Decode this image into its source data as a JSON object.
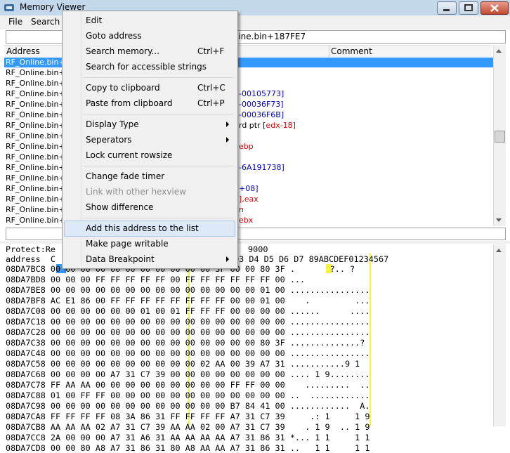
{
  "window": {
    "title": "Memory Viewer"
  },
  "menubar": {
    "file": "File",
    "search": "Search"
  },
  "address_bar": {
    "value": "line.bin+187FE7"
  },
  "disasm": {
    "col_address": "Address",
    "col_comment": "Comment",
    "rows": [
      {
        "addr": "RF_Online.bin+1",
        "a": "",
        "b": "",
        "color": ""
      },
      {
        "addr": "RF_Online.bin+1",
        "a": "",
        "b": "",
        "color": ""
      },
      {
        "addr": "RF_Online.bin+1",
        "a": "",
        "b": "",
        "color": ""
      },
      {
        "addr": "RF_Online.bin+1",
        "a": "-00105773]",
        "b": "",
        "color": "blue"
      },
      {
        "addr": "RF_Online.bin+1",
        "a": "-00036F73]",
        "b": "",
        "color": "blue"
      },
      {
        "addr": "RF_Online.bin+1",
        "a": "-00036F6B]",
        "b": "",
        "color": "blue"
      },
      {
        "addr": "RF_Online.bin+1",
        "a": "rd ptr [",
        "b": "edx-18]",
        "color": "mix"
      },
      {
        "addr": "RF_Online.bin+1",
        "a": "",
        "b": "",
        "color": ""
      },
      {
        "addr": "RF_Online.bin+1",
        "a": "ebp",
        "b": "",
        "color": "red"
      },
      {
        "addr": "RF_Online.bin+1",
        "a": "",
        "b": "",
        "color": ""
      },
      {
        "addr": "RF_Online.bin+1",
        "a": "-6A191738]",
        "b": "",
        "color": "blue"
      },
      {
        "addr": "RF_Online.bin+1",
        "a": "",
        "b": "",
        "color": ""
      },
      {
        "addr": "RF_Online.bin+1",
        "a": "+08]",
        "b": "",
        "color": "blue"
      },
      {
        "addr": "RF_Online.bin+1",
        "a": "],eax",
        "b": "",
        "color": "red"
      },
      {
        "addr": "RF_Online.bin+1",
        "a": "n",
        "b": "",
        "color": "red"
      },
      {
        "addr": "RF_Online.bin+1",
        "a": "ebx",
        "b": "",
        "color": "red"
      }
    ]
  },
  "hex": {
    "protect_prefix": "Protect:Re",
    "protect_suffix": "9000",
    "header_prefix": "address  C",
    "header_suffix": "D3 D4 D5 D6 D7 89ABCDEF01234567",
    "rows": [
      "08DA7BC8 00 00 00 00 00 00 00 00 00 00 00 3F 00 00 80 3F .       ?.. ?",
      "08DA7BD8 00 00 00 FF FF FF FF FF 00 FF FF FF FF FF FF 00 ...          ",
      "08DA7BE8 00 00 00 00 00 00 00 00 00 00 00 00 00 00 01 00 ................",
      "08DA7BF8 AC E1 86 00 FF FF FF FF FF FF FF FF 00 00 01 00    .         ...",
      "08DA7C08 00 00 00 00 00 00 01 00 01 FF FF FF 00 00 00 00 ......      ....",
      "08DA7C18 00 00 00 00 00 00 00 00 00 00 00 00 00 00 00 00 ................",
      "08DA7C28 00 00 00 00 00 00 00 00 00 00 00 00 00 00 00 00 ................",
      "08DA7C38 00 00 00 00 00 00 00 00 00 00 00 00 00 00 80 3F ..............?",
      "08DA7C48 00 00 00 00 00 00 00 00 00 00 00 00 00 00 00 00 ................",
      "08DA7C58 00 00 00 00 00 00 00 00 00 00 02 AA 00 39 A7 31 ...........9 1",
      "08DA7C68 00 00 00 00 A7 31 C7 39 00 00 00 00 00 00 00 00 .... 1 9........",
      "08DA7C78 FF AA AA 00 00 00 00 00 00 00 00 00 FF FF 00 00    .........  ..",
      "08DA7C88 01 00 FF FF 00 00 00 00 00 00 00 00 00 00 00 00 ..  ............",
      "08DA7C98 00 00 00 00 00 00 00 00 00 00 00 00 B7 84 41 00 ............  A.",
      "08DA7CA8 FF FF FF FF 08 3A 86 31 FF FF FF FF A7 31 C7 39     .: 1     1 9",
      "08DA7CB8 AA AA AA 02 A7 31 C7 39 AA AA 02 00 A7 31 C7 39    . 1 9  .. 1 9",
      "08DA7CC8 2A 00 00 00 A7 31 A6 31 AA AA AA AA A7 31 86 31 *... 1 1     1 1",
      "08DA7CD8 00 00 80 A8 A7 31 86 31 80 A8 AA AA A7 31 86 31 ..   1 1     1 1"
    ]
  },
  "context_menu": {
    "edit": "Edit",
    "goto": "Goto address",
    "search_memory": "Search memory...",
    "search_memory_key": "Ctrl+F",
    "search_strings": "Search for accessible strings",
    "copy": "Copy to clipboard",
    "copy_key": "Ctrl+C",
    "paste": "Paste from clipboard",
    "paste_key": "Ctrl+P",
    "display_type": "Display Type",
    "seperators": "Seperators",
    "lock_rowsize": "Lock current rowsize",
    "fade_timer": "Change fade timer",
    "link_hexview": "Link with other hexview",
    "show_diff": "Show difference",
    "add_address": "Add this address to the list",
    "make_writable": "Make page writable",
    "data_breakpoint": "Data Breakpoint"
  }
}
